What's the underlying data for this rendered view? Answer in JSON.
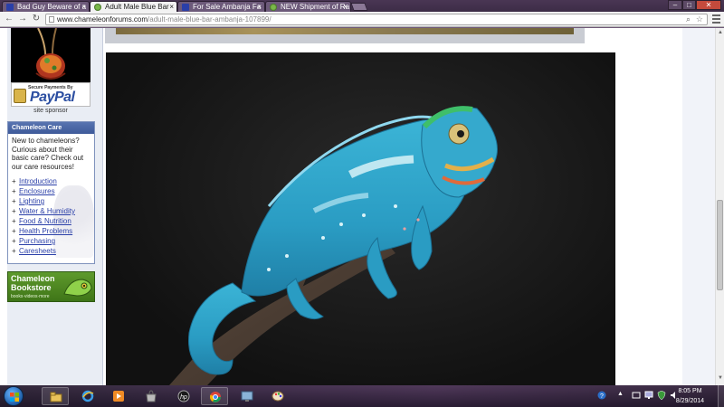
{
  "browser": {
    "tabs": [
      {
        "title": "Bad Guy Beware of a",
        "icon": "blue-square-favicon",
        "active": false
      },
      {
        "title": "Adult Male Blue Bar",
        "icon": "chameleon-favicon",
        "active": true
      },
      {
        "title": "For Sale Ambanja Fa",
        "icon": "blue-square-favicon",
        "active": false
      },
      {
        "title": "NEW Shipment of Ra",
        "icon": "chameleon-favicon",
        "active": false
      }
    ],
    "tab_close_glyph": "×",
    "url_host": "www.chameleonforums.com",
    "url_path": "/adult-male-blue-bar-ambanja-107899/",
    "window_controls": {
      "minimize": "–",
      "maximize": "□",
      "close": "✕"
    },
    "nav": {
      "back": "←",
      "forward": "→",
      "reload": "↻"
    }
  },
  "sidebar": {
    "ad": {
      "paypal_small": "Secure Payments By",
      "paypal_logo": "PayPal",
      "caption": "site sponsor"
    },
    "care_box": {
      "title": "Chameleon Care",
      "intro": "New to chameleons? Curious about their basic care? Check out our care resources!",
      "links": [
        "Introduction",
        "Enclosures",
        "Lighting",
        "Water & Humidity",
        "Food & Nutrition",
        "Health Problems",
        "Purchasing",
        "Caresheets"
      ],
      "bullet": "+"
    },
    "bookstore": {
      "title": "Chameleon Bookstore",
      "subtitle": "books·videos·more"
    }
  },
  "main": {
    "photo_subject": "blue-bar-ambanja-panther-chameleon-on-branch"
  },
  "taskbar": {
    "pinned": [
      "file-explorer-icon",
      "internet-explorer-icon",
      "media-player-icon",
      "store-icon",
      "hp-icon",
      "chrome-icon",
      "control-panel-icon",
      "paint-icon"
    ],
    "clock_time": "8:05 PM",
    "clock_date": "8/29/2014"
  },
  "colors": {
    "accent_blue": "#2a3fa8",
    "care_header": "#4a66a4",
    "bookstore_green": "#4f8a22",
    "chameleon_blue": "#2fa6c8"
  }
}
